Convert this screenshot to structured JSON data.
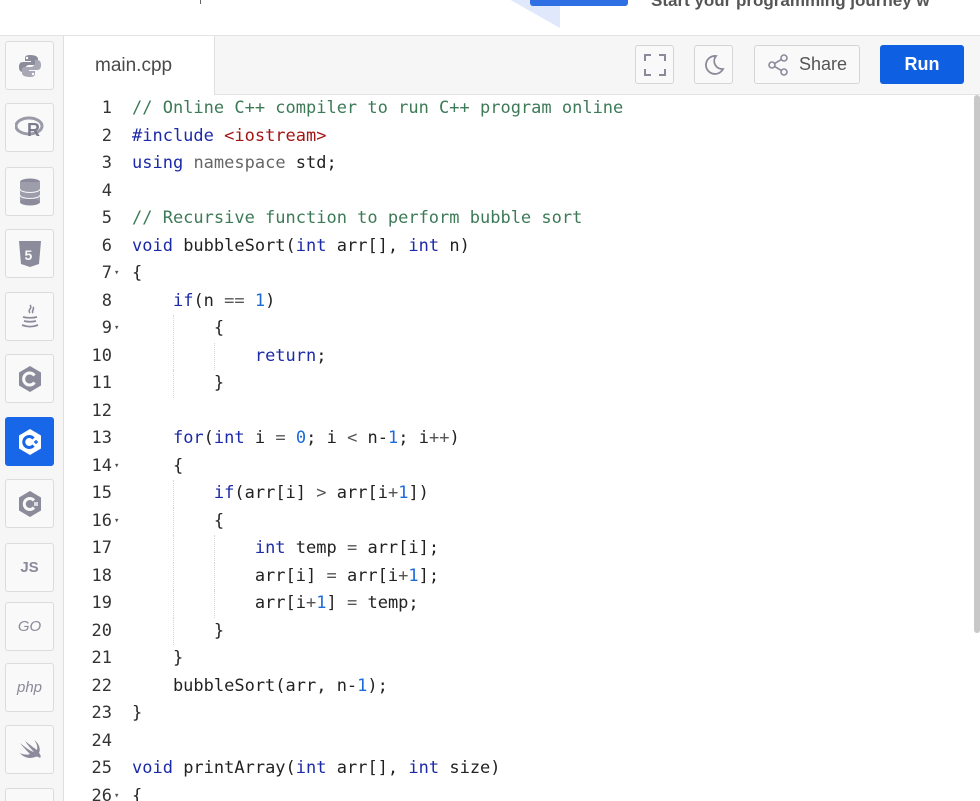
{
  "banner": {
    "text": "Start your programming journey w"
  },
  "rail": {
    "languages": [
      {
        "name": "python",
        "label": ""
      },
      {
        "name": "r",
        "label": ""
      },
      {
        "name": "sql",
        "label": ""
      },
      {
        "name": "html5",
        "label": ""
      },
      {
        "name": "java",
        "label": ""
      },
      {
        "name": "c",
        "label": ""
      },
      {
        "name": "cpp",
        "label": "",
        "active": true
      },
      {
        "name": "csharp",
        "label": ""
      },
      {
        "name": "javascript",
        "label": "JS"
      },
      {
        "name": "go",
        "label": "GO"
      },
      {
        "name": "php",
        "label": "php"
      },
      {
        "name": "swift",
        "label": ""
      }
    ]
  },
  "editor": {
    "filename": "main.cpp",
    "share_label": "Share",
    "run_label": "Run"
  },
  "code": {
    "line_numbers": [
      "1",
      "2",
      "3",
      "4",
      "5",
      "6",
      "7",
      "8",
      "9",
      "10",
      "11",
      "12",
      "13",
      "14",
      "15",
      "16",
      "17",
      "18",
      "19",
      "20",
      "21",
      "22",
      "23",
      "24",
      "25",
      "26"
    ],
    "lines": [
      "// Online C++ compiler to run C++ program online",
      "#include <iostream>",
      "using namespace std;",
      "",
      "// Recursive function to perform bubble sort",
      "void bubbleSort(int arr[], int n)",
      "{",
      "    if(n == 1)",
      "        {",
      "            return;",
      "        }",
      "",
      "    for(int i = 0; i < n-1; i++)",
      "    {",
      "        if(arr[i] > arr[i+1])",
      "        {",
      "            int temp = arr[i];",
      "            arr[i] = arr[i+1];",
      "            arr[i+1] = temp;",
      "        }",
      "    }",
      "    bubbleSort(arr, n-1);",
      "}",
      "",
      "void printArray(int arr[], int size)",
      "{"
    ]
  },
  "colors": {
    "accent": "#0f5fe3",
    "comment": "#3d7a57",
    "keyword": "#1b2aa8",
    "string": "#a31515",
    "number": "#1b6bd8"
  }
}
